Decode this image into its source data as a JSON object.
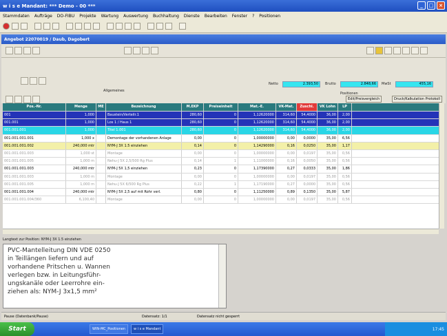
{
  "app": {
    "title": "w i s e   Mandant: *** Demo - 00 ***"
  },
  "menu": [
    "Stammdaten",
    "Aufträge",
    "DO-FIBU",
    "Projekte",
    "Wartung",
    "Auswertung",
    "Buchhaltung",
    "Dienste",
    "Bearbeiten",
    "Fenster",
    "?",
    "Positionen"
  ],
  "window": {
    "title": "Angebot 22070019 / Daub, Dagobert"
  },
  "form": {
    "allgemeines_label": "Allgemeines",
    "positionen_label": "Positionen",
    "netto_label": "Netto",
    "netto_value": "2.393,50",
    "brutto_label": "Brutto",
    "brutto_value": "2.848,66",
    "mwst_label": "MwSt",
    "mwst_value": "455,16",
    "btn_edit_prices": "Edit/Preisvergleich",
    "btn_copy": "Druck/Kalkulation Protokoll"
  },
  "grid": {
    "headers": [
      "Pos.-Nr.",
      "Menge",
      "ME",
      "Bezeichnung",
      "M.EKP",
      "Preiseinheit",
      "Mat.-E.",
      "VK-Mat.",
      "Zuschl.",
      "VK Lohn",
      "LP"
    ],
    "rows": [
      {
        "pos": "001",
        "menge": "1,000",
        "me": "",
        "bez": "Baustein/Verteilr.1",
        "ekp": "280,60",
        "pe": "0",
        "mat": "1,12620000",
        "vkm": "314,60",
        "zus": "54,4000",
        "vkl": "36,00",
        "lp": "2,00",
        "style": "r-blue"
      },
      {
        "pos": "001.001",
        "menge": "1,000",
        "me": "",
        "bez": "Los 1 / Haus 1",
        "ekp": "280,60",
        "pe": "0",
        "mat": "1,12620000",
        "vkm": "314,60",
        "zus": "54,4000",
        "vkl": "36,00",
        "lp": "2,00",
        "style": "r-blue"
      },
      {
        "pos": "001.001.001",
        "menge": "1,000",
        "me": "",
        "bez": "Titel 1.001",
        "ekp": "280,60",
        "pe": "0",
        "mat": "1,12620000",
        "vkm": "314,60",
        "zus": "54,4000",
        "vkl": "36,00",
        "lp": "2,00",
        "style": "r-cyan"
      },
      {
        "pos": "001.001.001.001",
        "menge": "1,000 x",
        "me": "",
        "bez": "Demontage der vorhandenen Anlage",
        "ekp": "0,00",
        "pe": "0",
        "mat": "1,00000000",
        "vkm": "0,00",
        "zus": "0,0000",
        "vkl": "35,00",
        "lp": "6,56",
        "style": ""
      },
      {
        "pos": "001.001.001.002",
        "menge": "240,000 mtr",
        "me": "",
        "bez": "NYM-J 3X 1.5     einziehen",
        "ekp": "0,14",
        "pe": "0",
        "mat": "1,14290000",
        "vkm": "0,16",
        "zus": "0,0250",
        "vkl": "35,00",
        "lp": "1,17",
        "style": "r-yellow"
      },
      {
        "pos": "001.001.001.003",
        "menge": "1,000 st",
        "me": "",
        "bez": "Montage",
        "ekp": "0,00",
        "pe": "0",
        "mat": "1,00000000",
        "vkm": "0,00",
        "zus": "0,0197",
        "vkl": "35,00",
        "lp": "0,56",
        "style": "r-gray"
      },
      {
        "pos": "001.001.001.005",
        "menge": "1,000 m",
        "me": "",
        "bez": "Nehu-J 5X 2,5/500 Rg    Plus",
        "ekp": "0,14",
        "pe": "1",
        "mat": "1,11000000",
        "vkm": "0,16",
        "zus": "0,0050",
        "vkl": "35,00",
        "lp": "0,56",
        "style": "r-gray"
      },
      {
        "pos": "001.001.001.003",
        "menge": "240,000 mtr",
        "me": "",
        "bez": "NYM-J  5X 1,5     einziehen",
        "ekp": "0,23",
        "pe": "0",
        "mat": "1,17390000",
        "vkm": "0,27",
        "zus": "0,0333",
        "vkl": "35,00",
        "lp": "1,86",
        "style": ""
      },
      {
        "pos": "001.001.001.003",
        "menge": "1,000 m",
        "me": "",
        "bez": "Montage",
        "ekp": "0,00",
        "pe": "0",
        "mat": "1,00000000",
        "vkm": "0,00",
        "zus": "0,0197",
        "vkl": "35,00",
        "lp": "0,56",
        "style": "r-gray"
      },
      {
        "pos": "001.001.001.005",
        "menge": "1,000 m",
        "me": "",
        "bez": "Nehu-J 5X 6/500 Rg    Plus",
        "ekp": "0,22",
        "pe": "1",
        "mat": "1,17190000",
        "vkm": "0,27",
        "zus": "0,0000",
        "vkl": "35,00",
        "lp": "0,56",
        "style": "r-gray"
      },
      {
        "pos": "001.001.001.004",
        "menge": "240,000 mtr",
        "me": "",
        "bez": "NYM-J 5X 2,5 auf mit Rohr verl.",
        "ekp": "0,80",
        "pe": "0",
        "mat": "1,11250000",
        "vkm": "0,89",
        "zus": "0,1350",
        "vkl": "35,00",
        "lp": "5,87",
        "style": ""
      },
      {
        "pos": "001.001.001.004/360",
        "menge": "6,100,40",
        "me": "",
        "bez": "Montage",
        "ekp": "0,00",
        "pe": "0",
        "mat": "1,00000000",
        "vkm": "0,00",
        "zus": "0,0197",
        "vkl": "35,00",
        "lp": "0,56",
        "style": "r-gray"
      }
    ]
  },
  "longtext": {
    "label": "Langtext zur Position: NYM-J  3X 1.5      einziehen",
    "lines": [
      "PVC-Mantelleitung DIN VDE 0250",
      "in Teillängen liefern und auf",
      "vorhandene Pritschen u. Wannen",
      "verlegen bzw. in Leitungsführ-",
      "ungskanäle oder Leerrohre ein-",
      "ziehen als:  NYM-J 3x1,5 mm²"
    ]
  },
  "status": {
    "left": "Pause (Datenbank/Pause)",
    "mid": "Datensatz: 1/1",
    "right": "Datensatz nicht gesperrt"
  },
  "taskbar": {
    "start": "Start",
    "tasks": [
      "WIN-MC_Positionen",
      "w i s e  Mandant"
    ],
    "clock": "17:45"
  }
}
